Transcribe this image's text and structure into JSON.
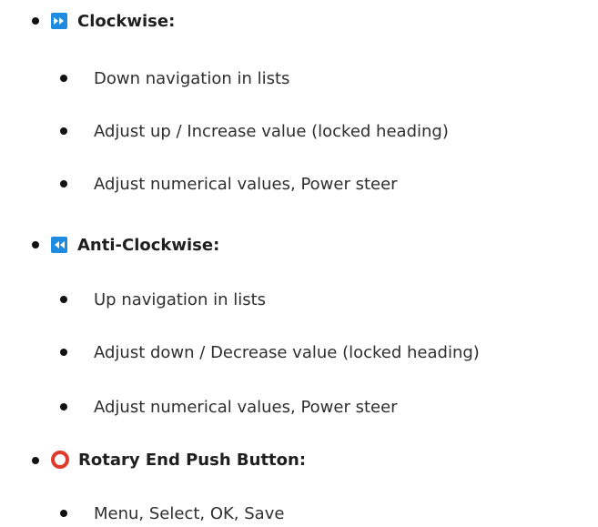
{
  "colors": {
    "icon_blue": "#1e8be0",
    "icon_red": "#e03a2a",
    "text": "#2b2b2b",
    "bullet": "#111111"
  },
  "sections": [
    {
      "icon": "fast-forward-icon",
      "title": "Clockwise:",
      "items": [
        "Down navigation in lists",
        "Adjust up / Increase value (locked heading)",
        "Adjust numerical values, Power steer"
      ]
    },
    {
      "icon": "rewind-icon",
      "title": "Anti-Clockwise:",
      "items": [
        "Up navigation in lists",
        "Adjust down / Decrease value (locked heading)",
        "Adjust numerical values, Power steer"
      ]
    },
    {
      "icon": "push-button-icon",
      "title": "Rotary End Push Button:",
      "items": [
        "Menu, Select, OK, Save"
      ]
    }
  ]
}
